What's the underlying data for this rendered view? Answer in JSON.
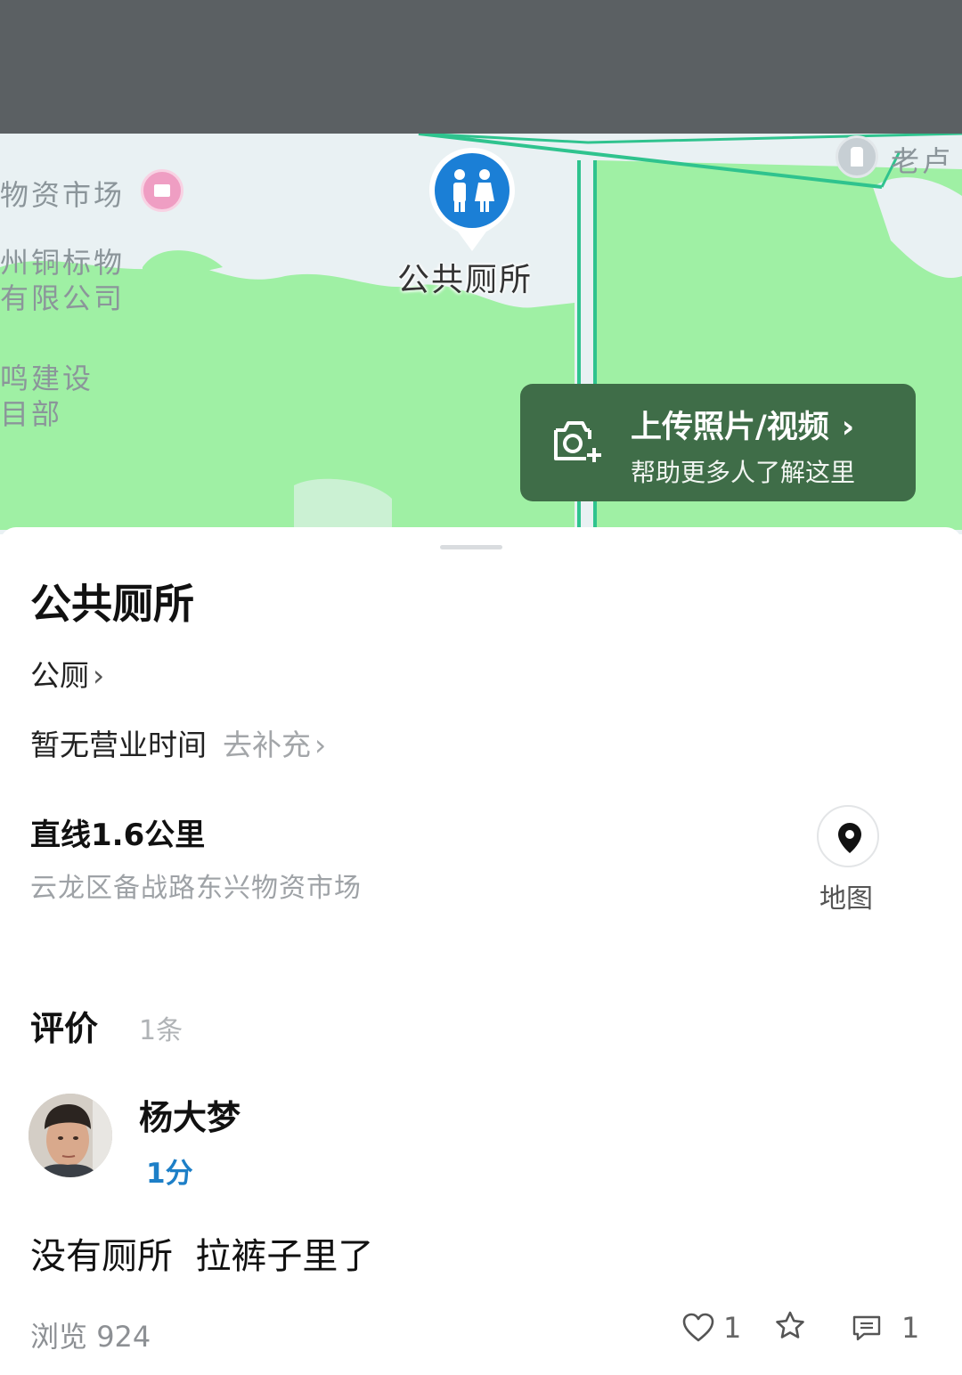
{
  "map": {
    "labels": {
      "market_partial": "物资市场",
      "company_line1": "州铜标物",
      "company_line2": "有限公司",
      "construction_line1": "鸣建设",
      "construction_line2": "目部",
      "top_right": "老卢"
    },
    "pin_label": "公共厕所",
    "upload": {
      "title": "上传照片/视频",
      "subtitle": "帮助更多人了解这里"
    }
  },
  "place": {
    "title": "公共厕所",
    "category": "公厕",
    "hours": "暂无营业时间",
    "hours_add": "去补充",
    "distance": "直线1.6公里",
    "address": "云龙区备战路东兴物资市场",
    "map_button_label": "地图"
  },
  "reviews": {
    "heading": "评价",
    "count": "1条",
    "items": [
      {
        "user": "杨大梦",
        "score": "1分",
        "text": "没有厕所  拉裤子里了"
      }
    ]
  },
  "footer": {
    "views_label": "浏览",
    "views_count": "924",
    "likes": "1",
    "comments": "1"
  },
  "colors": {
    "accent_blue": "#1d7fc7",
    "map_green": "#9ff0a4",
    "card_green": "#3f6d48"
  }
}
